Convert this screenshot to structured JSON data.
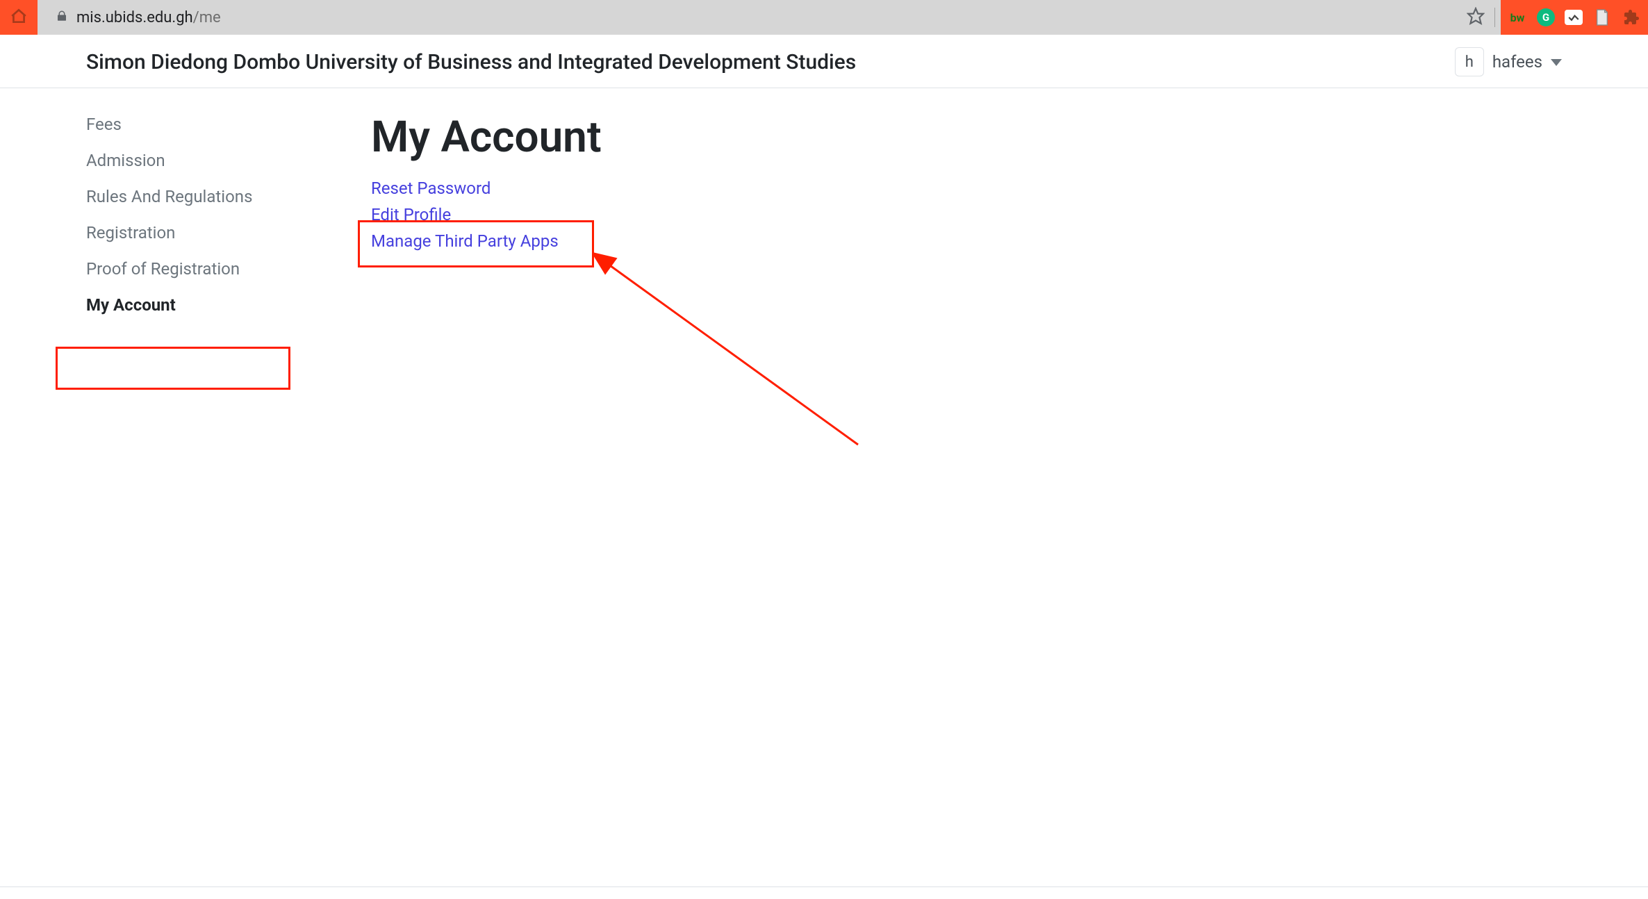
{
  "browser": {
    "url_host": "mis.ubids.edu.gh",
    "url_path": "/me"
  },
  "header": {
    "site_title": "Simon Diedong Dombo University of Business and Integrated Development Studies",
    "avatar_letter": "h",
    "username": "hafees"
  },
  "sidebar": {
    "items": [
      {
        "label": "Fees",
        "active": false
      },
      {
        "label": "Admission",
        "active": false
      },
      {
        "label": "Rules And Regulations",
        "active": false
      },
      {
        "label": "Registration",
        "active": false
      },
      {
        "label": "Proof of Registration",
        "active": false
      },
      {
        "label": "My Account",
        "active": true
      }
    ]
  },
  "main": {
    "page_title": "My Account",
    "links": [
      {
        "label": "Reset Password"
      },
      {
        "label": "Edit Profile"
      },
      {
        "label": "Manage Third Party Apps"
      }
    ]
  }
}
